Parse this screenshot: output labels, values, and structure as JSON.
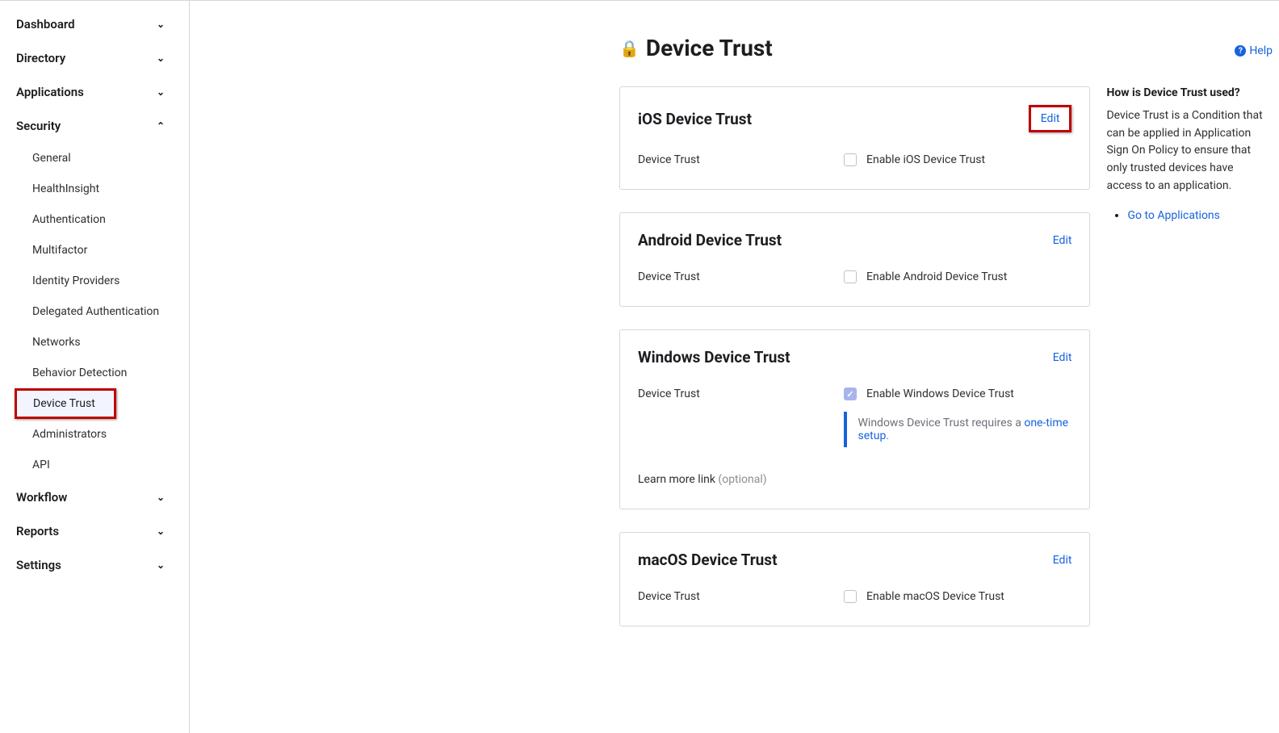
{
  "sidebar": {
    "items": [
      {
        "label": "Dashboard",
        "expanded": false
      },
      {
        "label": "Directory",
        "expanded": false
      },
      {
        "label": "Applications",
        "expanded": false
      },
      {
        "label": "Security",
        "expanded": true,
        "children": [
          "General",
          "HealthInsight",
          "Authentication",
          "Multifactor",
          "Identity Providers",
          "Delegated Authentication",
          "Networks",
          "Behavior Detection",
          "Device Trust",
          "Administrators",
          "API"
        ]
      },
      {
        "label": "Workflow",
        "expanded": false
      },
      {
        "label": "Reports",
        "expanded": false
      },
      {
        "label": "Settings",
        "expanded": false
      }
    ],
    "active_sub": "Device Trust"
  },
  "page": {
    "title": "Device Trust",
    "help_label": "Help"
  },
  "cards": {
    "ios": {
      "title": "iOS Device Trust",
      "edit": "Edit",
      "row_label": "Device Trust",
      "checkbox_label": "Enable iOS Device Trust",
      "checked": false
    },
    "android": {
      "title": "Android Device Trust",
      "edit": "Edit",
      "row_label": "Device Trust",
      "checkbox_label": "Enable Android Device Trust",
      "checked": false
    },
    "windows": {
      "title": "Windows Device Trust",
      "edit": "Edit",
      "row_label": "Device Trust",
      "checkbox_label": "Enable Windows Device Trust",
      "checked": true,
      "info_prefix": "Windows Device Trust requires a ",
      "info_link": "one-time setup",
      "info_suffix": ".",
      "learn_label": "Learn more link ",
      "learn_optional": "(optional)"
    },
    "macos": {
      "title": "macOS Device Trust",
      "edit": "Edit",
      "row_label": "Device Trust",
      "checkbox_label": "Enable macOS Device Trust",
      "checked": false
    }
  },
  "help_panel": {
    "heading": "How is Device Trust used?",
    "body": "Device Trust is a Condition that can be applied in Application Sign On Policy to ensure that only trusted devices have access to an application.",
    "link": "Go to Applications"
  }
}
